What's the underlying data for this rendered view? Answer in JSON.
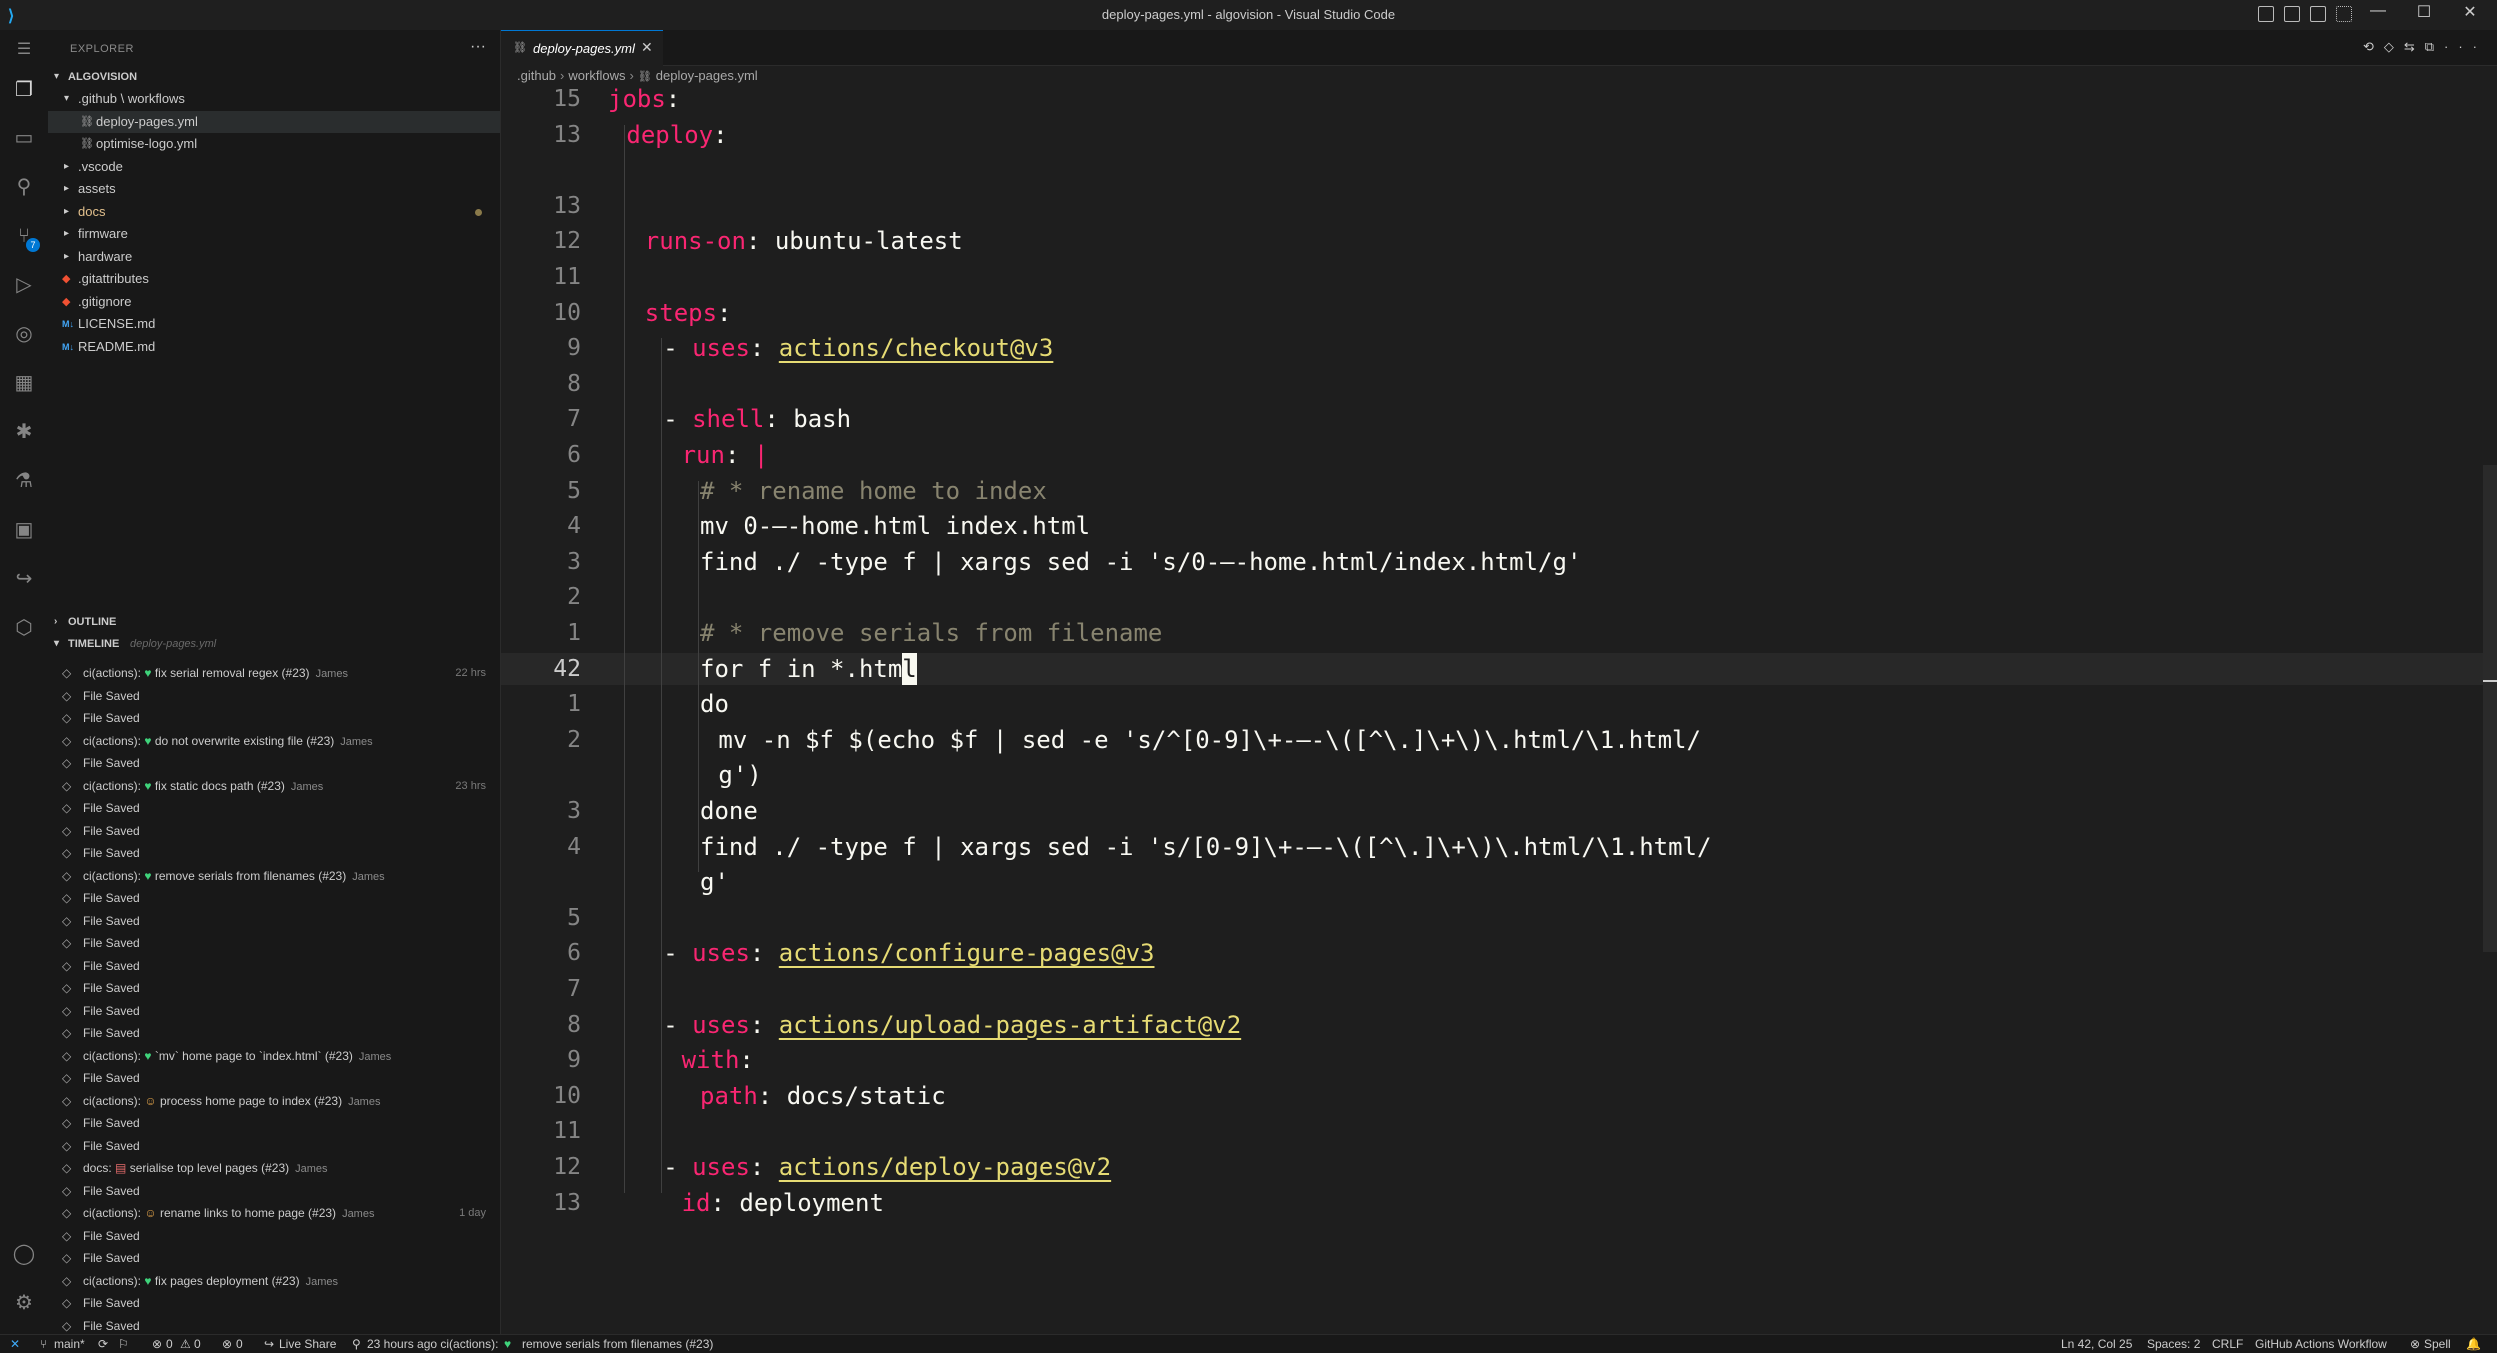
{
  "window": {
    "title": "deploy-pages.yml - algovision - Visual Studio Code"
  },
  "activity_bar": {
    "source_control_badge": "7"
  },
  "explorer": {
    "header": "EXPLORER",
    "root": "ALGOVISION",
    "items": [
      {
        "label": ".github \\ workflows",
        "type": "folder",
        "open": true,
        "indent": 0
      },
      {
        "label": "deploy-pages.yml",
        "type": "yaml",
        "indent": 1,
        "selected": true
      },
      {
        "label": "optimise-logo.yml",
        "type": "yaml",
        "indent": 1
      },
      {
        "label": ".vscode",
        "type": "folder",
        "indent": 0
      },
      {
        "label": "assets",
        "type": "folder",
        "indent": 0
      },
      {
        "label": "docs",
        "type": "folder",
        "indent": 0,
        "modified": true
      },
      {
        "label": "firmware",
        "type": "folder",
        "indent": 0
      },
      {
        "label": "hardware",
        "type": "folder",
        "indent": 0
      },
      {
        "label": ".gitattributes",
        "type": "git",
        "indent": 0
      },
      {
        "label": ".gitignore",
        "type": "git",
        "indent": 0
      },
      {
        "label": "LICENSE.md",
        "type": "md",
        "indent": 0
      },
      {
        "label": "README.md",
        "type": "md",
        "indent": 0
      }
    ]
  },
  "outline": {
    "header": "OUTLINE"
  },
  "timeline": {
    "header": "TIMELINE",
    "file": "deploy-pages.yml",
    "entries": [
      {
        "prefix": "ci(actions):",
        "emoji": "heart",
        "text": "fix serial removal regex (#23)",
        "author": "James",
        "when": "22 hrs"
      },
      {
        "text": "File Saved"
      },
      {
        "text": "File Saved"
      },
      {
        "prefix": "ci(actions):",
        "emoji": "heart",
        "text": "do not overwrite existing file (#23)",
        "author": "James"
      },
      {
        "text": "File Saved"
      },
      {
        "prefix": "ci(actions):",
        "emoji": "heart",
        "text": "fix static docs path (#23)",
        "author": "James",
        "when": "23 hrs"
      },
      {
        "text": "File Saved"
      },
      {
        "text": "File Saved"
      },
      {
        "text": "File Saved"
      },
      {
        "prefix": "ci(actions):",
        "emoji": "heart",
        "text": "remove serials from filenames (#23)",
        "author": "James"
      },
      {
        "text": "File Saved"
      },
      {
        "text": "File Saved"
      },
      {
        "text": "File Saved"
      },
      {
        "text": "File Saved"
      },
      {
        "text": "File Saved"
      },
      {
        "text": "File Saved"
      },
      {
        "text": "File Saved"
      },
      {
        "prefix": "ci(actions):",
        "emoji": "heart",
        "text": "`mv` home page to `index.html` (#23)",
        "author": "James"
      },
      {
        "text": "File Saved"
      },
      {
        "prefix": "ci(actions):",
        "emoji": "person",
        "text": "process home page to index (#23)",
        "author": "James"
      },
      {
        "text": "File Saved"
      },
      {
        "text": "File Saved"
      },
      {
        "prefix": "docs:",
        "emoji": "doc",
        "text": "serialise top level pages (#23)",
        "author": "James"
      },
      {
        "text": "File Saved"
      },
      {
        "prefix": "ci(actions):",
        "emoji": "person",
        "text": "rename links to home page (#23)",
        "author": "James",
        "when": "1 day"
      },
      {
        "text": "File Saved"
      },
      {
        "text": "File Saved"
      },
      {
        "prefix": "ci(actions):",
        "emoji": "heart",
        "text": "fix pages deployment (#23)",
        "author": "James"
      },
      {
        "text": "File Saved"
      },
      {
        "text": "File Saved"
      }
    ]
  },
  "editor": {
    "tab_label": "deploy-pages.yml",
    "breadcrumbs": [
      ".github",
      "workflows",
      "deploy-pages.yml"
    ],
    "lines": [
      {
        "n": "15",
        "indent": 0,
        "tokens": [
          [
            "k",
            "jobs"
          ],
          [
            "s",
            ":"
          ]
        ]
      },
      {
        "n": "13",
        "indent": 1,
        "tokens": [
          [
            "k",
            "deploy"
          ],
          [
            "s",
            ":"
          ]
        ]
      },
      {
        "n": "",
        "indent": 0,
        "tokens": []
      },
      {
        "n": "13",
        "indent": 0,
        "tokens": []
      },
      {
        "n": "12",
        "indent": 2,
        "tokens": [
          [
            "k",
            "runs-on"
          ],
          [
            "s",
            ": ubuntu-latest"
          ]
        ]
      },
      {
        "n": "11",
        "indent": 0,
        "tokens": []
      },
      {
        "n": "10",
        "indent": 2,
        "tokens": [
          [
            "k",
            "steps"
          ],
          [
            "s",
            ":"
          ]
        ]
      },
      {
        "n": "9",
        "indent": 3,
        "tokens": [
          [
            "s",
            "- "
          ],
          [
            "k",
            "uses"
          ],
          [
            "s",
            ": "
          ],
          [
            "u",
            "actions/checkout@v3"
          ]
        ]
      },
      {
        "n": "8",
        "indent": 0,
        "tokens": []
      },
      {
        "n": "7",
        "indent": 3,
        "tokens": [
          [
            "s",
            "- "
          ],
          [
            "k",
            "shell"
          ],
          [
            "s",
            ": bash"
          ]
        ]
      },
      {
        "n": "6",
        "indent": 4,
        "tokens": [
          [
            "k",
            "run"
          ],
          [
            "s",
            ": "
          ],
          [
            "k",
            "|"
          ]
        ]
      },
      {
        "n": "5",
        "indent": 5,
        "tokens": [
          [
            "c",
            "# * rename home to index"
          ]
        ]
      },
      {
        "n": "4",
        "indent": 5,
        "tokens": [
          [
            "s",
            "mv 0-—-home.html index.html"
          ]
        ]
      },
      {
        "n": "3",
        "indent": 5,
        "tokens": [
          [
            "s",
            "find ./ -type f | xargs sed -i 's/0-—-home.html/index.html/g'"
          ]
        ]
      },
      {
        "n": "2",
        "indent": 0,
        "tokens": []
      },
      {
        "n": "1",
        "indent": 5,
        "tokens": [
          [
            "c",
            "# * remove serials from filename"
          ]
        ]
      },
      {
        "n": "42",
        "indent": 5,
        "current": true,
        "tokens": [
          [
            "s",
            "for f in *.htm"
          ],
          [
            "cursor",
            "l"
          ]
        ]
      },
      {
        "n": "1",
        "indent": 5,
        "tokens": [
          [
            "s",
            "do"
          ]
        ]
      },
      {
        "n": "2",
        "indent": 6,
        "tokens": [
          [
            "s",
            "mv -n $f $(echo $f | sed -e 's/^[0-9]\\+-—-\\([^\\.]\\+\\)\\.html/\\1.html/"
          ]
        ]
      },
      {
        "n": "",
        "indent": 6,
        "tokens": [
          [
            "s",
            "g')"
          ]
        ]
      },
      {
        "n": "3",
        "indent": 5,
        "tokens": [
          [
            "s",
            "done"
          ]
        ]
      },
      {
        "n": "4",
        "indent": 5,
        "tokens": [
          [
            "s",
            "find ./ -type f | xargs sed -i 's/[0-9]\\+-—-\\([^\\.]\\+\\)\\.html/\\1.html/"
          ]
        ]
      },
      {
        "n": "",
        "indent": 5,
        "tokens": [
          [
            "s",
            "g'"
          ]
        ]
      },
      {
        "n": "5",
        "indent": 0,
        "tokens": []
      },
      {
        "n": "6",
        "indent": 3,
        "tokens": [
          [
            "s",
            "- "
          ],
          [
            "k",
            "uses"
          ],
          [
            "s",
            ": "
          ],
          [
            "u",
            "actions/configure-pages@v3"
          ]
        ]
      },
      {
        "n": "7",
        "indent": 0,
        "tokens": []
      },
      {
        "n": "8",
        "indent": 3,
        "tokens": [
          [
            "s",
            "- "
          ],
          [
            "k",
            "uses"
          ],
          [
            "s",
            ": "
          ],
          [
            "u",
            "actions/upload-pages-artifact@v2"
          ]
        ]
      },
      {
        "n": "9",
        "indent": 4,
        "tokens": [
          [
            "k",
            "with"
          ],
          [
            "s",
            ":"
          ]
        ]
      },
      {
        "n": "10",
        "indent": 5,
        "tokens": [
          [
            "k",
            "path"
          ],
          [
            "s",
            ": docs/static"
          ]
        ]
      },
      {
        "n": "11",
        "indent": 0,
        "tokens": []
      },
      {
        "n": "12",
        "indent": 3,
        "tokens": [
          [
            "s",
            "- "
          ],
          [
            "k",
            "uses"
          ],
          [
            "s",
            ": "
          ],
          [
            "u",
            "actions/deploy-pages@v2"
          ]
        ]
      },
      {
        "n": "13",
        "indent": 4,
        "tokens": [
          [
            "k",
            "id"
          ],
          [
            "s",
            ": deployment"
          ]
        ]
      }
    ]
  },
  "status_bar": {
    "branch": "main*",
    "errors": "0",
    "warnings": "0",
    "ports": "0",
    "live_share": "Live Share",
    "last_commit": "23 hours ago ci(actions):",
    "last_commit_msg": "remove serials from filenames (#23)",
    "position": "Ln 42, Col 25",
    "spaces": "Spaces: 2",
    "eol": "CRLF",
    "language": "GitHub Actions Workflow",
    "spell": "Spell"
  },
  "colors": {
    "keyword": "#f92672",
    "string_link": "#e6db74",
    "comment": "#88846f",
    "text": "#f8f8f2",
    "accent": "#0078d4"
  }
}
